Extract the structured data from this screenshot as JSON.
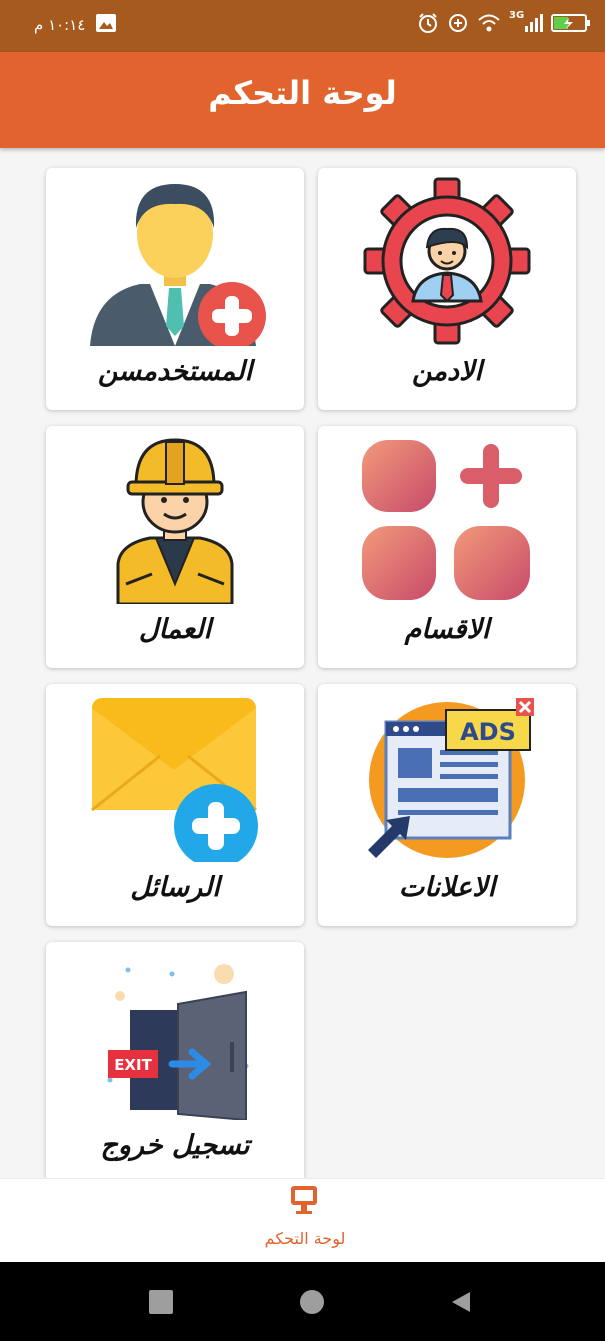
{
  "status_bar": {
    "time": "١٠:١٤ م",
    "icons": [
      "image-icon",
      "alarm-icon",
      "data-saver-icon",
      "wifi-icon",
      "signal-3g-icon",
      "battery-charging-icon"
    ],
    "network_label": "3G"
  },
  "app_bar": {
    "title": "لوحة التحكم"
  },
  "cards": [
    {
      "label": "الادمن",
      "icon": "admin-gear-icon"
    },
    {
      "label": "المستخدمسن",
      "icon": "add-user-icon"
    },
    {
      "label": "الاقسام",
      "icon": "add-category-icon"
    },
    {
      "label": "العمال",
      "icon": "worker-icon"
    },
    {
      "label": "الاعلانات",
      "icon": "ads-icon"
    },
    {
      "label": "الرسائل",
      "icon": "add-message-icon"
    },
    {
      "label": "تسجيل خروج",
      "icon": "exit-door-icon"
    }
  ],
  "ad_badge": "ADS",
  "exit_sign": "EXIT",
  "bottom_nav": {
    "label": "لوحة التحكم",
    "icon": "monitor-icon"
  },
  "system_nav": [
    "recent-apps-icon",
    "home-icon",
    "back-icon"
  ],
  "colors": {
    "app_bar": "#e1632d",
    "status_bar": "#a65a1e",
    "background": "#f5f5f5",
    "accent": "#e1632d"
  }
}
